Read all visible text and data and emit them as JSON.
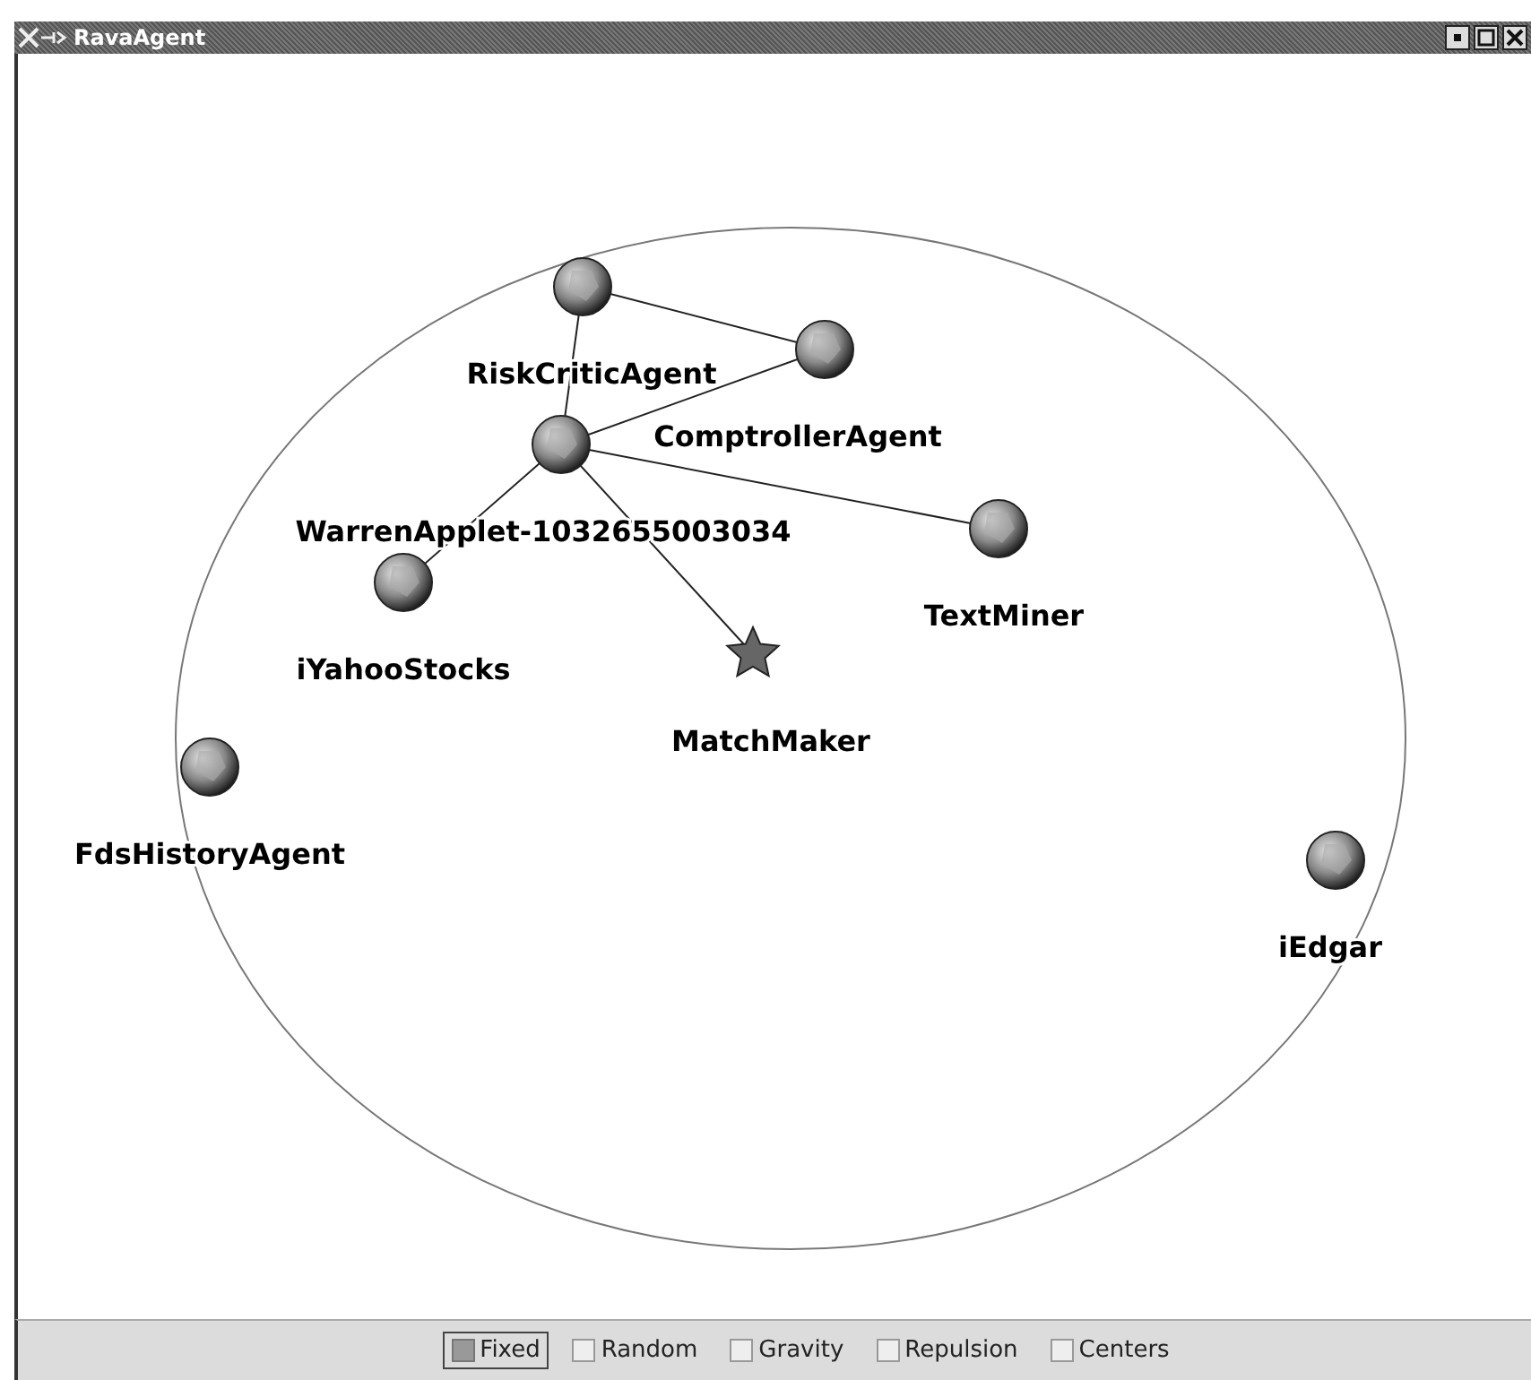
{
  "window": {
    "title": "RavaAgent"
  },
  "nodes": [
    {
      "label": "RiskCriticAgent",
      "kind": "agent"
    },
    {
      "label": "ComptrollerAgent",
      "kind": "agent"
    },
    {
      "label": "WarrenApplet-1032655003034",
      "kind": "agent"
    },
    {
      "label": "TextMiner",
      "kind": "agent"
    },
    {
      "label": "iYahooStocks",
      "kind": "agent"
    },
    {
      "label": "MatchMaker",
      "kind": "star"
    },
    {
      "label": "FdsHistoryAgent",
      "kind": "agent"
    },
    {
      "label": "iEdgar",
      "kind": "agent"
    }
  ],
  "options": [
    {
      "label": "Fixed",
      "checked": true,
      "focused": true
    },
    {
      "label": "Random",
      "checked": false,
      "focused": false
    },
    {
      "label": "Gravity",
      "checked": false,
      "focused": false
    },
    {
      "label": "Repulsion",
      "checked": false,
      "focused": false
    },
    {
      "label": "Centers",
      "checked": false,
      "focused": false
    }
  ]
}
